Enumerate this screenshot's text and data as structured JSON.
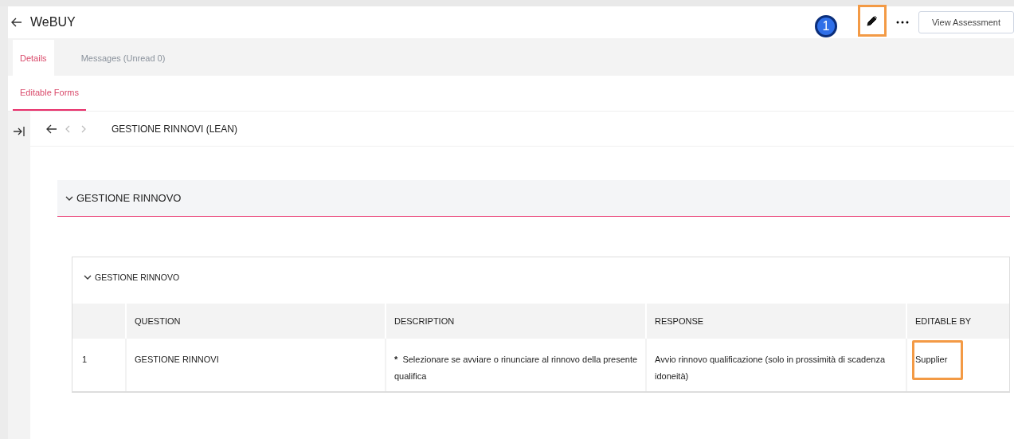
{
  "header": {
    "title": "WeBUY",
    "badge": "1",
    "edit_highlighted": true,
    "view_button": "View Assessment"
  },
  "tabs": [
    {
      "label": "Details",
      "selected": true
    },
    {
      "label": "Messages (Unread 0)",
      "selected": false
    }
  ],
  "subtabs": [
    {
      "label": "Editable Forms",
      "selected": true
    }
  ],
  "breadcrumb": {
    "title": "GESTIONE RINNOVI (LEAN)",
    "prev_disabled": true,
    "next_disabled": true
  },
  "section": {
    "title": "GESTIONE RINNOVO",
    "expanded": true
  },
  "table": {
    "title": "GESTIONE RINNOVO",
    "expanded": true,
    "columns": [
      "QUESTION",
      "DESCRIPTION",
      "RESPONSE",
      "EDITABLE BY"
    ],
    "rows": [
      {
        "number": "1",
        "question": "GESTIONE RINNOVI",
        "marker": "*",
        "description": "Selezionare se avviare o rinunciare al rinnovo della presente qualifica",
        "response": "Avvio rinnovo qualificazione (solo in prossimità di scadenza idoneità)",
        "editable_by": "Supplier",
        "editable_by_highlighted": true
      }
    ]
  }
}
